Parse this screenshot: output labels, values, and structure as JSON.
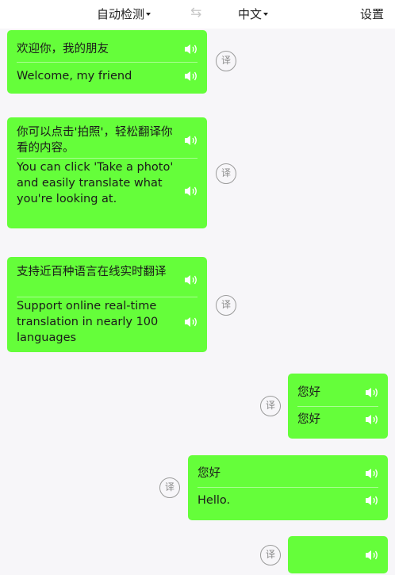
{
  "topbar": {
    "source_lang": "自动检测",
    "target_lang": "中文",
    "settings": "设置"
  },
  "translate_icon_text": "译",
  "messages": [
    {
      "side": "left",
      "original": "欢迎你，我的朋友",
      "translation": "Welcome, my friend"
    },
    {
      "side": "left",
      "original": "你可以点击'拍照'，轻松翻译你看的内容。",
      "translation": "You can click 'Take a photo' and easily translate what you're looking at."
    },
    {
      "side": "left",
      "original": "支持近百种语言在线实时翻译",
      "translation": "Support online real-time translation in nearly 100 languages"
    },
    {
      "side": "right",
      "original": "您好",
      "translation": "您好"
    },
    {
      "side": "right",
      "original": "您好",
      "translation": "Hello."
    },
    {
      "side": "right",
      "original": "",
      "translation": ""
    }
  ],
  "colors": {
    "bubble": "#65fe3a",
    "speaker": "#ffffff",
    "background": "#f7f6f9"
  }
}
